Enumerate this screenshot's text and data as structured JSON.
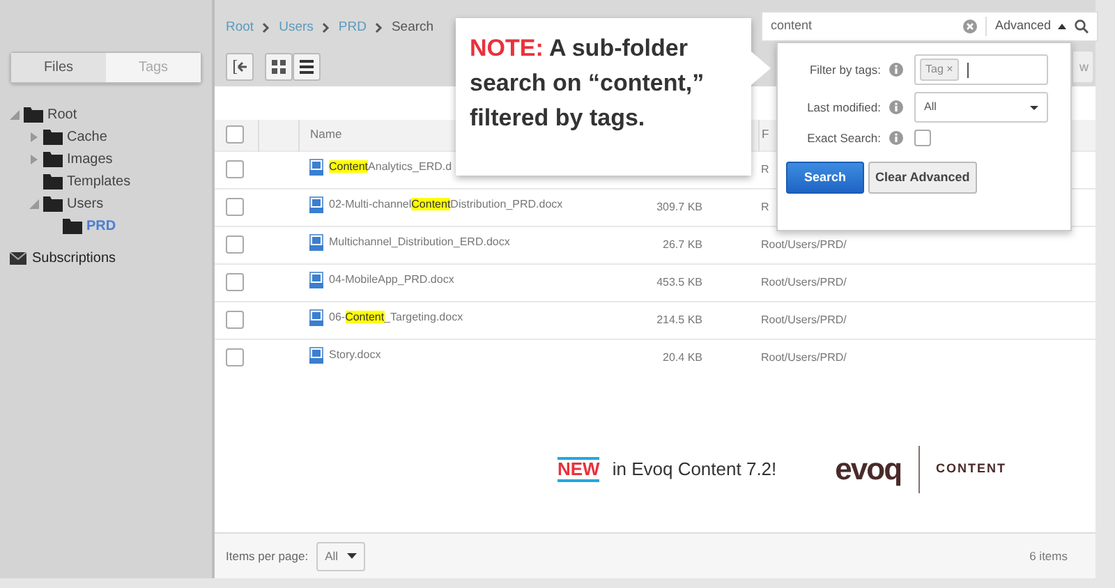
{
  "sidebar": {
    "tabs": [
      {
        "label": "Files",
        "selected": true
      },
      {
        "label": "Tags",
        "selected": false
      }
    ],
    "tree": [
      {
        "label": "Root",
        "selected": false,
        "expanded": true,
        "children": [
          {
            "label": "Cache",
            "selected": false,
            "expanded": false
          },
          {
            "label": "Images",
            "selected": false,
            "expanded": false
          },
          {
            "label": "Templates",
            "selected": false
          },
          {
            "label": "Users",
            "selected": false,
            "expanded": true,
            "children": [
              {
                "label": "PRD",
                "selected": true
              }
            ]
          }
        ]
      }
    ],
    "subscriptions": "Subscriptions"
  },
  "breadcrumb": [
    {
      "label": "Root",
      "link": true
    },
    {
      "label": "Users",
      "link": true
    },
    {
      "label": "PRD",
      "link": true
    },
    {
      "label": "Search",
      "link": false
    }
  ],
  "toolbar": {
    "new_button": "w"
  },
  "search": {
    "value": "content",
    "advanced": "Advanced"
  },
  "advanced_panel": {
    "fields": [
      {
        "kind": "tags",
        "label": "Filter by tags:",
        "tags": [
          {
            "label": "Tag",
            "remove": "×"
          }
        ]
      },
      {
        "kind": "select",
        "label": "Last modified:",
        "value": "All"
      },
      {
        "kind": "checkbox",
        "label": "Exact Search:",
        "checked": false
      }
    ],
    "buttons": [
      {
        "label": "Search",
        "kind": "primary"
      },
      {
        "label": "Clear Advanced",
        "kind": "secondary"
      }
    ]
  },
  "table": {
    "header": {
      "checked": false,
      "name": "Name",
      "path": "F"
    },
    "rows": [
      {
        "checked": false,
        "name": [
          {
            "text": "Content",
            "highlight": true
          },
          {
            "text": "Analytics_ERD.d",
            "highlight": false
          }
        ],
        "path": "R"
      },
      {
        "checked": false,
        "name": [
          {
            "text": "02-Multi-channel",
            "highlight": false
          },
          {
            "text": "Content",
            "highlight": true
          },
          {
            "text": "Distribution_PRD.docx",
            "highlight": false
          }
        ],
        "size": "309.7 KB",
        "path": "R"
      },
      {
        "checked": false,
        "name": [
          {
            "text": "Multichannel_Distribution_ERD.docx",
            "highlight": false
          }
        ],
        "size": "26.7 KB",
        "path": "Root/Users/PRD/"
      },
      {
        "checked": false,
        "name": [
          {
            "text": "04-MobileApp_PRD.docx",
            "highlight": false
          }
        ],
        "size": "453.5 KB",
        "path": "Root/Users/PRD/"
      },
      {
        "checked": false,
        "name": [
          {
            "text": "06-",
            "highlight": false
          },
          {
            "text": "Content",
            "highlight": true
          },
          {
            "text": "_Targeting.docx",
            "highlight": false
          }
        ],
        "size": "214.5 KB",
        "path": "Root/Users/PRD/"
      },
      {
        "checked": false,
        "name": [
          {
            "text": "Story.docx",
            "highlight": false
          }
        ],
        "size": "20.4 KB",
        "path": "Root/Users/PRD/"
      }
    ]
  },
  "callout": {
    "note": "NOTE:",
    "text": "A sub-folder search on “content,” filtered by tags."
  },
  "promo": {
    "badge": "NEW",
    "text": "in Evoq Content 7.2!",
    "logo": "evoq",
    "product": "CONTENT"
  },
  "footer": {
    "per_page_label": "Items per page:",
    "per_page": "All",
    "count": "6 items"
  }
}
